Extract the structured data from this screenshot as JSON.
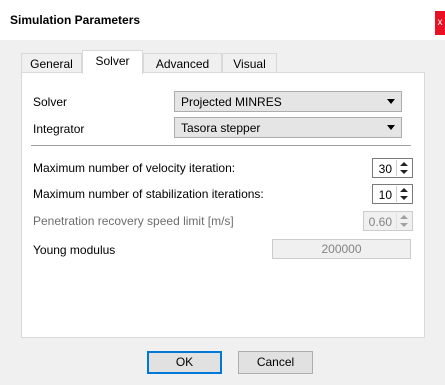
{
  "window": {
    "title": "Simulation Parameters",
    "close_glyph": "x"
  },
  "tabs": [
    {
      "label": "General"
    },
    {
      "label": "Solver",
      "active": true
    },
    {
      "label": "Advanced"
    },
    {
      "label": "Visual"
    }
  ],
  "solver": {
    "solver_label": "Solver",
    "solver_value": "Projected MINRES",
    "integrator_label": "Integrator",
    "integrator_value": "Tasora stepper"
  },
  "params": {
    "velocity_label": "Maximum number of velocity iteration:",
    "velocity_value": "30",
    "stabilization_label": "Maximum number of stabilization iterations:",
    "stabilization_value": "10",
    "penetration_label": "Penetration recovery speed limit [m/s]",
    "penetration_value": "0.60",
    "young_label": "Young modulus",
    "young_value": "200000"
  },
  "buttons": {
    "ok": "OK",
    "cancel": "Cancel"
  }
}
